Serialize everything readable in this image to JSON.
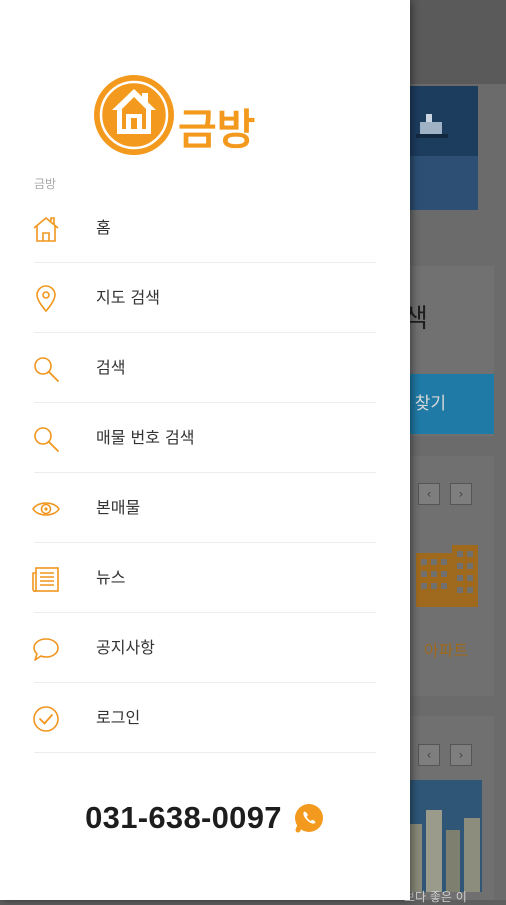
{
  "background": {
    "search_title": "색",
    "find_button_label": "찾기",
    "apartment_label": "아파트",
    "carousel_prev": "‹",
    "carousel_next": "›",
    "bottom_text": "보다 좋은 이"
  },
  "drawer": {
    "logo_text": "금방",
    "section_label": "금방",
    "menu_items": [
      {
        "label": "홈",
        "icon": "home-icon"
      },
      {
        "label": "지도 검색",
        "icon": "map-pin-icon"
      },
      {
        "label": "검색",
        "icon": "search-icon"
      },
      {
        "label": "매물 번호 검색",
        "icon": "search-icon"
      },
      {
        "label": "본매물",
        "icon": "eye-icon"
      },
      {
        "label": "뉴스",
        "icon": "news-icon"
      },
      {
        "label": "공지사항",
        "icon": "speech-bubble-icon"
      },
      {
        "label": "로그인",
        "icon": "check-circle-icon"
      }
    ],
    "phone_number": "031-638-0097",
    "phone_icon": "phone-icon"
  },
  "colors": {
    "accent": "#f0961e",
    "scrim": "#5e5e5e",
    "drawer_bg": "#ffffff"
  }
}
